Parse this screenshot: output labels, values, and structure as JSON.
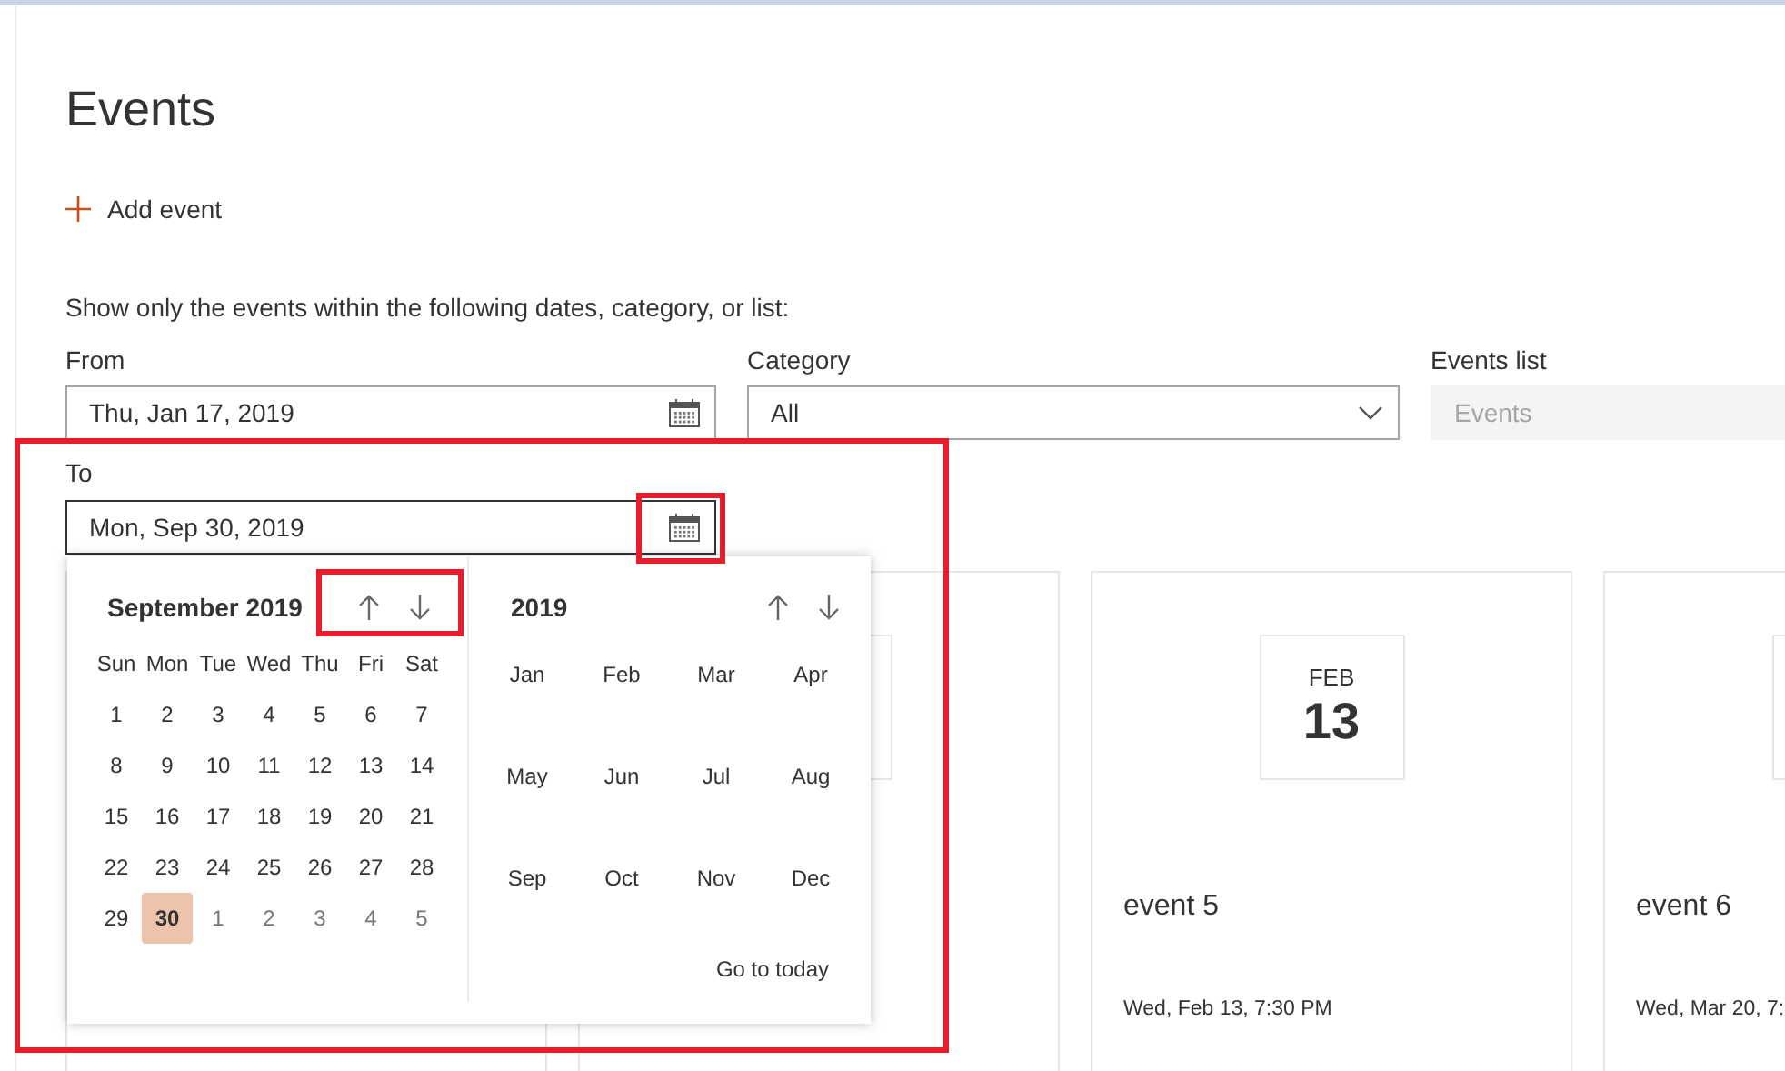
{
  "page": {
    "title": "Events"
  },
  "add_event": {
    "label": "Add event"
  },
  "filter": {
    "description": "Show only the events within the following dates, category, or list:",
    "from": {
      "label": "From",
      "value": "Thu, Jan 17, 2019"
    },
    "category": {
      "label": "Category",
      "value": "All"
    },
    "events_list": {
      "label": "Events list",
      "placeholder": "Events",
      "disabled": true
    },
    "to": {
      "label": "To",
      "value": "Mon, Sep 30, 2019"
    }
  },
  "date_picker": {
    "month_title": "September 2019",
    "weekdays": [
      "Sun",
      "Mon",
      "Tue",
      "Wed",
      "Thu",
      "Fri",
      "Sat"
    ],
    "days": [
      {
        "label": "1",
        "in_month": true,
        "selected": false
      },
      {
        "label": "2",
        "in_month": true,
        "selected": false
      },
      {
        "label": "3",
        "in_month": true,
        "selected": false
      },
      {
        "label": "4",
        "in_month": true,
        "selected": false
      },
      {
        "label": "5",
        "in_month": true,
        "selected": false
      },
      {
        "label": "6",
        "in_month": true,
        "selected": false
      },
      {
        "label": "7",
        "in_month": true,
        "selected": false
      },
      {
        "label": "8",
        "in_month": true,
        "selected": false
      },
      {
        "label": "9",
        "in_month": true,
        "selected": false
      },
      {
        "label": "10",
        "in_month": true,
        "selected": false
      },
      {
        "label": "11",
        "in_month": true,
        "selected": false
      },
      {
        "label": "12",
        "in_month": true,
        "selected": false
      },
      {
        "label": "13",
        "in_month": true,
        "selected": false
      },
      {
        "label": "14",
        "in_month": true,
        "selected": false
      },
      {
        "label": "15",
        "in_month": true,
        "selected": false
      },
      {
        "label": "16",
        "in_month": true,
        "selected": false
      },
      {
        "label": "17",
        "in_month": true,
        "selected": false
      },
      {
        "label": "18",
        "in_month": true,
        "selected": false
      },
      {
        "label": "19",
        "in_month": true,
        "selected": false
      },
      {
        "label": "20",
        "in_month": true,
        "selected": false
      },
      {
        "label": "21",
        "in_month": true,
        "selected": false
      },
      {
        "label": "22",
        "in_month": true,
        "selected": false
      },
      {
        "label": "23",
        "in_month": true,
        "selected": false
      },
      {
        "label": "24",
        "in_month": true,
        "selected": false
      },
      {
        "label": "25",
        "in_month": true,
        "selected": false
      },
      {
        "label": "26",
        "in_month": true,
        "selected": false
      },
      {
        "label": "27",
        "in_month": true,
        "selected": false
      },
      {
        "label": "28",
        "in_month": true,
        "selected": false
      },
      {
        "label": "29",
        "in_month": true,
        "selected": false
      },
      {
        "label": "30",
        "in_month": true,
        "selected": true
      },
      {
        "label": "1",
        "in_month": false,
        "selected": false
      },
      {
        "label": "2",
        "in_month": false,
        "selected": false
      },
      {
        "label": "3",
        "in_month": false,
        "selected": false
      },
      {
        "label": "4",
        "in_month": false,
        "selected": false
      },
      {
        "label": "5",
        "in_month": false,
        "selected": false
      }
    ],
    "year_title": "2019",
    "months": [
      {
        "label": "Jan",
        "selected": false
      },
      {
        "label": "Feb",
        "selected": false
      },
      {
        "label": "Mar",
        "selected": false
      },
      {
        "label": "Apr",
        "selected": false
      },
      {
        "label": "May",
        "selected": false
      },
      {
        "label": "Jun",
        "selected": false
      },
      {
        "label": "Jul",
        "selected": false
      },
      {
        "label": "Aug",
        "selected": false
      },
      {
        "label": "Sep",
        "selected": false
      },
      {
        "label": "Oct",
        "selected": false
      },
      {
        "label": "Nov",
        "selected": false
      },
      {
        "label": "Dec",
        "selected": false
      }
    ],
    "go_to_today": "Go to today"
  },
  "cards": [
    {
      "kind": "covered"
    },
    {
      "kind": "covered"
    },
    {
      "kind": "event",
      "month": "FEB",
      "day": "13",
      "title": "event 5",
      "date": "Wed, Feb 13, 7:30 PM"
    },
    {
      "kind": "event",
      "title": "event 6",
      "date": "Wed, Mar 20, 7:"
    }
  ]
}
